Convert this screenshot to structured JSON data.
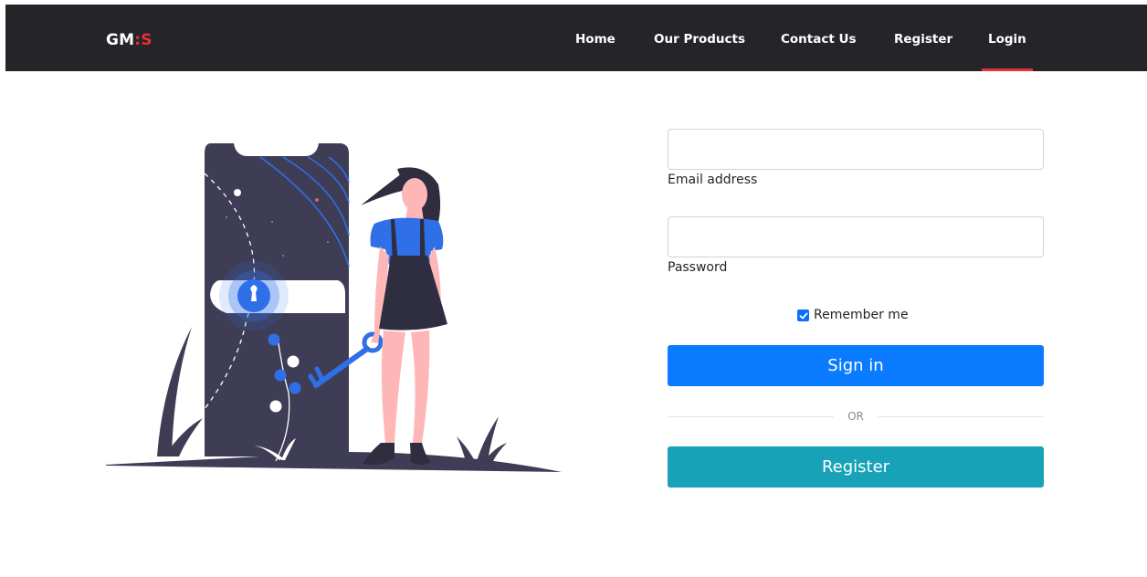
{
  "brand": {
    "text_main": "GM",
    "text_sep": ":",
    "text_accent": "S"
  },
  "nav": {
    "items": [
      {
        "label": "Home"
      },
      {
        "label": "Our Products"
      },
      {
        "label": "Contact Us"
      },
      {
        "label": "Register"
      },
      {
        "label": "Login"
      }
    ],
    "active": "Login"
  },
  "form": {
    "email": {
      "label": "Email address",
      "value": "",
      "placeholder": ""
    },
    "password": {
      "label": "Password",
      "value": "",
      "placeholder": ""
    },
    "remember": {
      "label": "Remember me",
      "checked": true
    },
    "signin_label": "Sign in",
    "or_label": "OR",
    "register_label": "Register"
  },
  "colors": {
    "navbar": "#252428",
    "accent_red": "#e8303a",
    "primary_blue": "#0a7bff",
    "teal": "#17a2b8",
    "illustration_dark": "#3f3d56",
    "illustration_blue": "#2f6fe8",
    "skin": "#ffb6b6"
  },
  "icons": {
    "illustration": "lock-phone-illustration",
    "checkbox": "check-icon"
  }
}
